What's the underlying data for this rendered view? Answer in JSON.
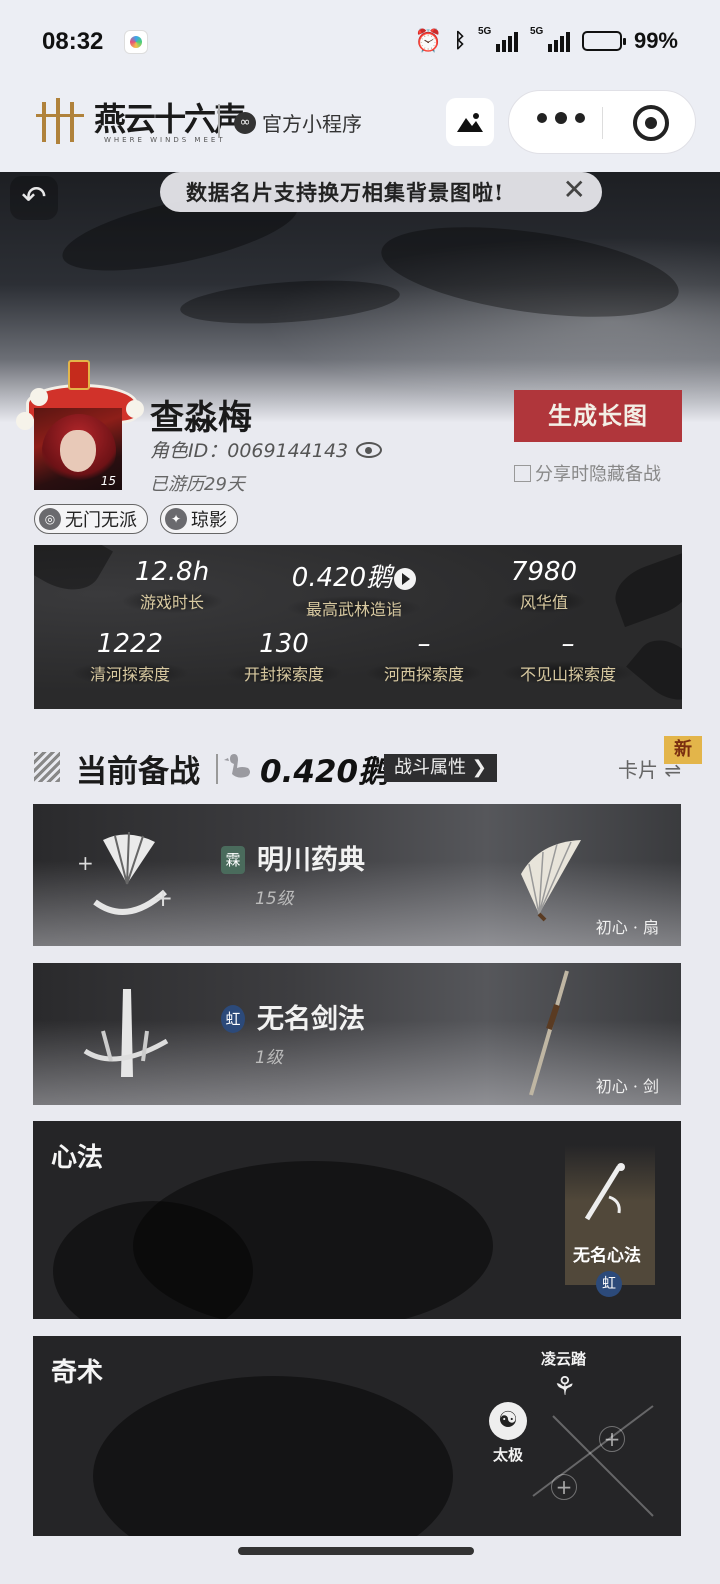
{
  "status_bar": {
    "time": "08:32",
    "battery": "99%",
    "net1": "5G",
    "net2": "5G"
  },
  "nav": {
    "logo_text": "燕云十六声",
    "logo_sub": "WHERE WINDS MEET",
    "official_label": "官方小程序"
  },
  "banner": {
    "text": "数据名片支持换万相集背景图啦!",
    "close": "✕"
  },
  "profile": {
    "name": "查淼梅",
    "role_id": "角色ID：0069144143",
    "days": "已游历29天",
    "level": "15",
    "generate_button": "生成长图",
    "hide_option": "分享时隐藏备战",
    "tags": [
      "无门无派",
      "琼影"
    ]
  },
  "stats": [
    {
      "value": "12.8h",
      "label": "游戏时长"
    },
    {
      "value": "0.420鹅",
      "label": "最高武林造诣"
    },
    {
      "value": "7980",
      "label": "风华值"
    },
    {
      "value": "1222",
      "label": "清河探索度"
    },
    {
      "value": "130",
      "label": "开封探索度"
    },
    {
      "value": "–",
      "label": "河西探索度"
    },
    {
      "value": "–",
      "label": "不见山探索度"
    }
  ],
  "section": {
    "title": "当前备战",
    "score": "0.420鹅",
    "attr_button": "战斗属性",
    "card_toggle": "卡片",
    "new_badge": "新"
  },
  "weapons": [
    {
      "badge": "霖",
      "badge_color": "#4a6b5c",
      "name": "明川药典",
      "level": "15级",
      "type": "初心 · 扇"
    },
    {
      "badge": "虹",
      "badge_color": "#2c4a7a",
      "name": "无名剑法",
      "level": "1级",
      "type": "初心 · 剑"
    }
  ],
  "xinfa": {
    "title": "心法",
    "skill_name": "无名心法",
    "skill_badge": "虹"
  },
  "qishu": {
    "title": "奇术",
    "skill_top": "凌云踏",
    "skill_left": "太极"
  },
  "colors": {
    "accent_red": "#b0363b",
    "gold": "#e3b54a",
    "dark_panel": "#2b2b2d"
  }
}
